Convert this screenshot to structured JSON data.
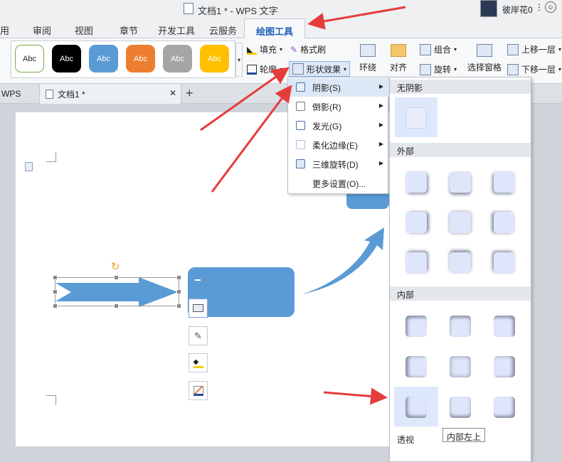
{
  "window": {
    "title": "文档1 * - WPS 文字"
  },
  "tabs": [
    {
      "label": "用"
    },
    {
      "label": "审阅"
    },
    {
      "label": "视图"
    },
    {
      "label": "章节"
    },
    {
      "label": "开发工具"
    },
    {
      "label": "云服务"
    },
    {
      "label": "绘图工具"
    }
  ],
  "user": {
    "name": "彼岸花0"
  },
  "ribbon": {
    "style_label": "Abc",
    "fill": "填充",
    "format_painter": "格式刷",
    "outline": "轮廓",
    "shape_effects": "形状效果",
    "wrap": "环绕",
    "align": "对齐",
    "group": "组合",
    "rotate": "旋转",
    "selection_pane": "选择窗格",
    "bring_forward": "上移一层",
    "send_backward": "下移一层"
  },
  "doc_tabs": [
    {
      "label": "WPS"
    },
    {
      "label": "文档1 *"
    }
  ],
  "effects_menu": [
    {
      "label": "阴影(S)"
    },
    {
      "label": "倒影(R)"
    },
    {
      "label": "发光(G)"
    },
    {
      "label": "柔化边缘(E)"
    },
    {
      "label": "三维旋转(D)"
    },
    {
      "label": "更多设置(O)..."
    }
  ],
  "shadow_flyout": {
    "sections": [
      "无阴影",
      "外部",
      "内部",
      "透视"
    ],
    "tooltip": "内部左上"
  },
  "colors": {
    "accent": "#1f5fb5",
    "shape_blue": "#5b9bd5",
    "arrow_red": "#e63b3b"
  }
}
